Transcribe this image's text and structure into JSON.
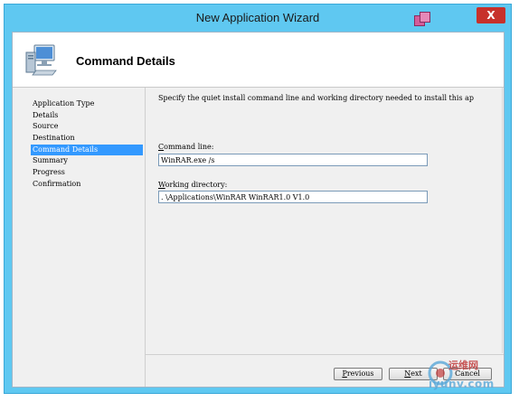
{
  "window": {
    "title": "New Application Wizard",
    "close_label": "X"
  },
  "header": {
    "title": "Command Details"
  },
  "nav": {
    "items": [
      {
        "label": "Application Type"
      },
      {
        "label": "Details"
      },
      {
        "label": "Source"
      },
      {
        "label": "Destination"
      },
      {
        "label": "Command Details"
      },
      {
        "label": "Summary"
      },
      {
        "label": "Progress"
      },
      {
        "label": "Confirmation"
      }
    ],
    "active": "Command Details"
  },
  "main": {
    "description": "Specify the quiet install command line and working directory needed to install this ap",
    "command_line": {
      "label_accel": "C",
      "label_rest": "ommand line:",
      "value": "WinRAR.exe /s"
    },
    "working_dir": {
      "label_accel": "W",
      "label_rest": "orking directory:",
      "value": ". \\Applications\\WinRAR WinRAR1.0 V1.0"
    }
  },
  "buttons": {
    "previous": {
      "accel": "P",
      "rest": "revious"
    },
    "next": {
      "accel": "N",
      "rest": "ext"
    },
    "cancel": {
      "label": "Cancel"
    }
  },
  "watermark": {
    "line1": "运维网",
    "line2": "iyunv.com"
  }
}
